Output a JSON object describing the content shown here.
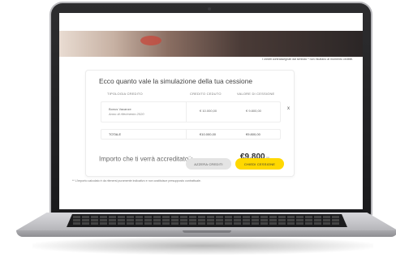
{
  "top_note": "I crediti contrassegnati dal simbolo * non risultano al momento cedibili.",
  "simulation": {
    "title": "Ecco quanto vale la simulazione della tua cessione",
    "columns": [
      "TIPOLOGIA CREDITO",
      "CREDITO CEDUTO",
      "VALORE DI CESSIONE"
    ],
    "rows": [
      {
        "name": "Bonus Vacanze",
        "sub": "Anno di riferimento 2020",
        "credit": "€ 10.000,00",
        "value": "€ 9.800,00",
        "remove": "x"
      }
    ],
    "total": {
      "label": "TOTALE",
      "credit": "€10.000,00",
      "value": "€9.800,00"
    },
    "amount_label": "Importo che ti verrà accreditato",
    "amount_mark": "**",
    "amount_value": "€9.800",
    "amount_cents": ",00",
    "buttons": {
      "reset": "AZZERA CREDITI",
      "request": "CHIEDI CESSIONE"
    },
    "footnote": "** L'importo calcolato è da ritenersi puramente indicativo e non costituisce presupposto contrattuale."
  },
  "colors": {
    "accent": "#ffd800",
    "secondary_button": "#e4e4e4"
  }
}
